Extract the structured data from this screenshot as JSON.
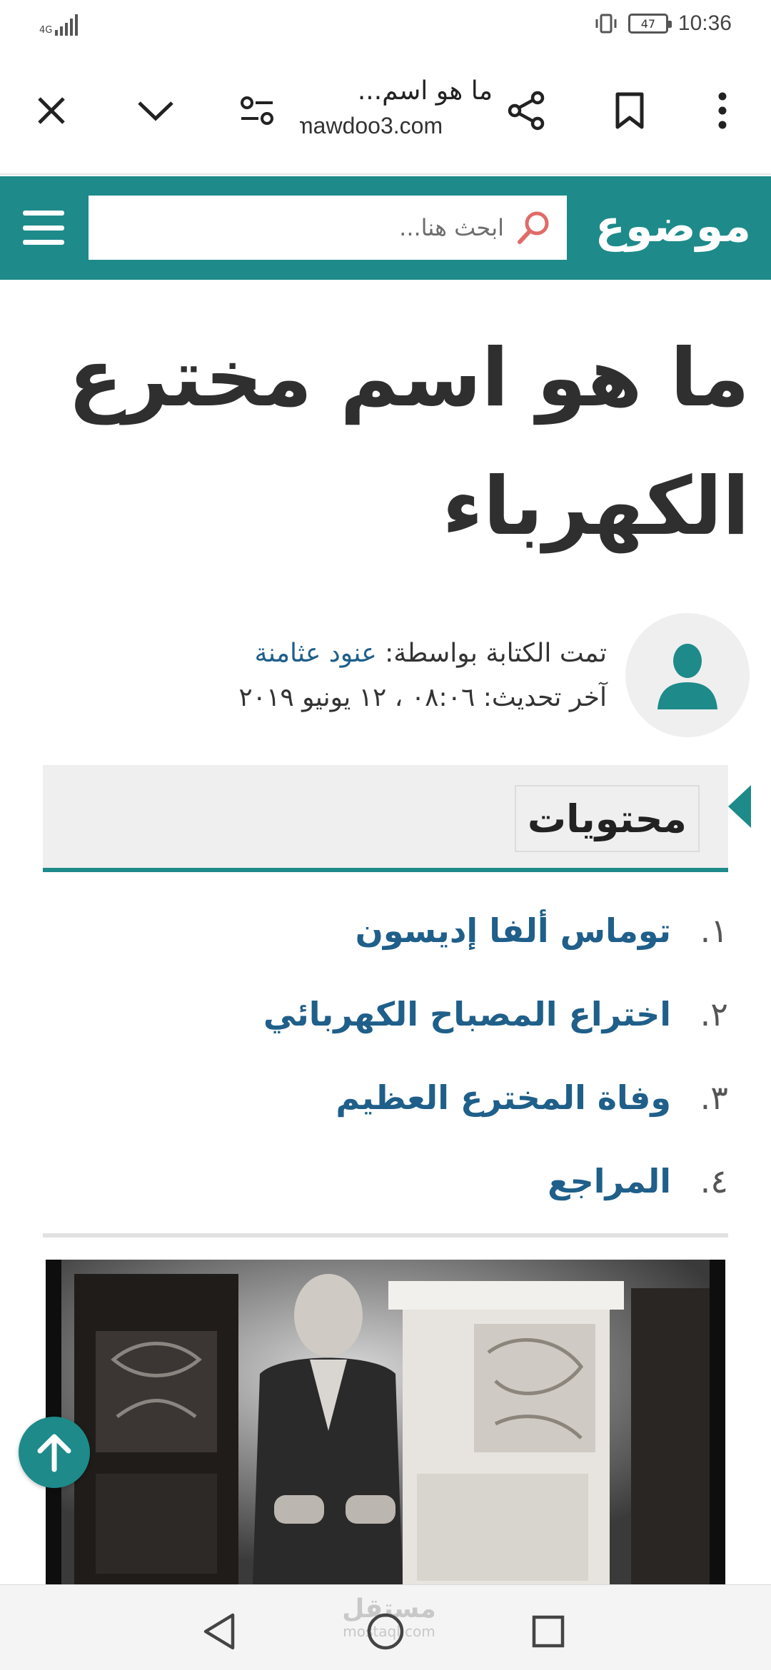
{
  "status_bar": {
    "network": "4G",
    "battery": "47",
    "time": "10:36"
  },
  "browser": {
    "page_title": "ما هو اسم...",
    "domain": "mawdoo3.com",
    "icons": [
      "close-icon",
      "chevron-down-icon",
      "page-settings-icon",
      "share-icon",
      "bookmark-icon",
      "more-vert-icon"
    ]
  },
  "site": {
    "logo": "موضوع",
    "search_placeholder": "ابحث هنا...",
    "accent_color": "#1e8a8a",
    "link_color": "#1f5f8a"
  },
  "article": {
    "title": "ما هو اسم مخترع الكهرباء",
    "author_prefix": "تمت الكتابة بواسطة: ",
    "author_name": "عنود عثامنة",
    "updated": "آخر تحديث: ٠٨:٠٦ ، ١٢ يونيو ٢٠١٩"
  },
  "toc": {
    "title": "محتويات",
    "items": [
      {
        "num": "١.",
        "label": "توماس ألفا إديسون"
      },
      {
        "num": "٢.",
        "label": "اختراع المصباح الكهربائي"
      },
      {
        "num": "٣.",
        "label": "وفاة المخترع العظيم"
      },
      {
        "num": "٤.",
        "label": "المراجع"
      }
    ]
  },
  "watermark": {
    "arabic": "مستقل",
    "latin": "mostaql.com"
  }
}
